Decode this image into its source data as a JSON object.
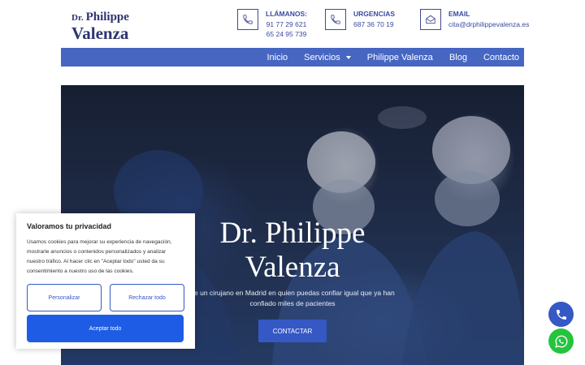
{
  "logo": {
    "dr": "Dr.",
    "first": "Philippe",
    "last": "Valenza"
  },
  "contacts": {
    "phone": {
      "label": "LLÁMANOS:",
      "line1": "91 77 29 621",
      "line2": "65 24 95 739",
      "icon": "phone-icon"
    },
    "urgent": {
      "label": "URGENCIAS",
      "line1": "687 36 70 19",
      "icon": "phone-icon"
    },
    "email": {
      "label": "EMAIL",
      "line1": "cita@drphilippevalenza.es",
      "icon": "envelope-icon"
    }
  },
  "nav": {
    "items": [
      "Inicio",
      "Servicios",
      "Philippe Valenza",
      "Blog",
      "Contacto"
    ]
  },
  "hero": {
    "title_line1": "Dr. Philippe",
    "title_line2": "Valenza",
    "subtitle": "ge un cirujano en Madrid en quien puedas confiar igual que ya han confiado miles de pacientes",
    "button": "CONTACTAR"
  },
  "cookie": {
    "title": "Valoramos tu privacidad",
    "text": "Usamos cookies para mejorar su experiencia de navegación, mostrarle anuncios o contenidos personalizados y analizar nuestro tráfico. Al hacer clic en \"Aceptar todo\" usted da su consentimiento a nuestro uso de las cookies.",
    "customize": "Personalizar",
    "reject": "Rechazar todo",
    "accept": "Aceptar todo"
  },
  "colors": {
    "brand": "#2e3470",
    "nav": "#4666c2",
    "accent": "#3558c5",
    "accept": "#1e5ce6",
    "whatsapp": "#26c43e"
  },
  "floating": {
    "phone_icon": "phone-icon",
    "whatsapp_icon": "whatsapp-icon"
  }
}
